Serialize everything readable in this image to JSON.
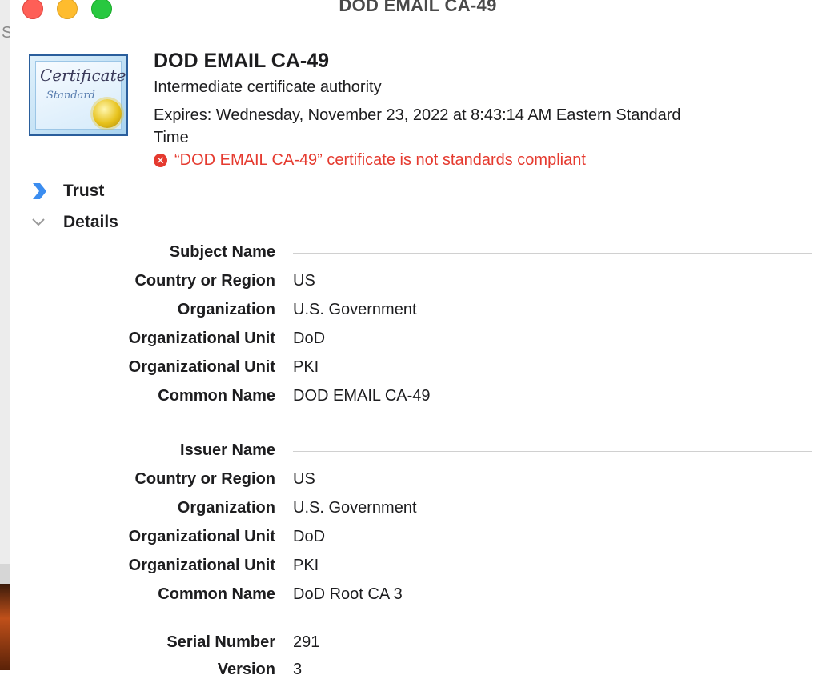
{
  "window": {
    "title": "DOD EMAIL CA-49"
  },
  "background": {
    "partial_letter": "S"
  },
  "certificate": {
    "image_text_1": "Certificate",
    "image_text_2": "Standard",
    "name": "DOD EMAIL CA-49",
    "kind": "Intermediate certificate authority",
    "expires": "Expires: Wednesday, November 23, 2022 at 8:43:14 AM Eastern Standard Time",
    "warning": "“DOD EMAIL CA-49” certificate is not standards compliant",
    "warning_icon_glyph": "✕"
  },
  "sections": {
    "trust_label": "Trust",
    "details_label": "Details"
  },
  "details": {
    "subject_header": "Subject Name",
    "subject": [
      {
        "label": "Country or Region",
        "value": "US"
      },
      {
        "label": "Organization",
        "value": "U.S. Government"
      },
      {
        "label": "Organizational Unit",
        "value": "DoD"
      },
      {
        "label": "Organizational Unit",
        "value": "PKI"
      },
      {
        "label": "Common Name",
        "value": "DOD EMAIL CA-49"
      }
    ],
    "issuer_header": "Issuer Name",
    "issuer": [
      {
        "label": "Country or Region",
        "value": "US"
      },
      {
        "label": "Organization",
        "value": "U.S. Government"
      },
      {
        "label": "Organizational Unit",
        "value": "DoD"
      },
      {
        "label": "Organizational Unit",
        "value": "PKI"
      },
      {
        "label": "Common Name",
        "value": "DoD Root CA 3"
      }
    ],
    "serial": {
      "label": "Serial Number",
      "value": "291"
    },
    "version": {
      "label": "Version",
      "value": "3"
    }
  },
  "colors": {
    "error": "#e53a2f",
    "disclosure_blue": "#3b8df0"
  }
}
